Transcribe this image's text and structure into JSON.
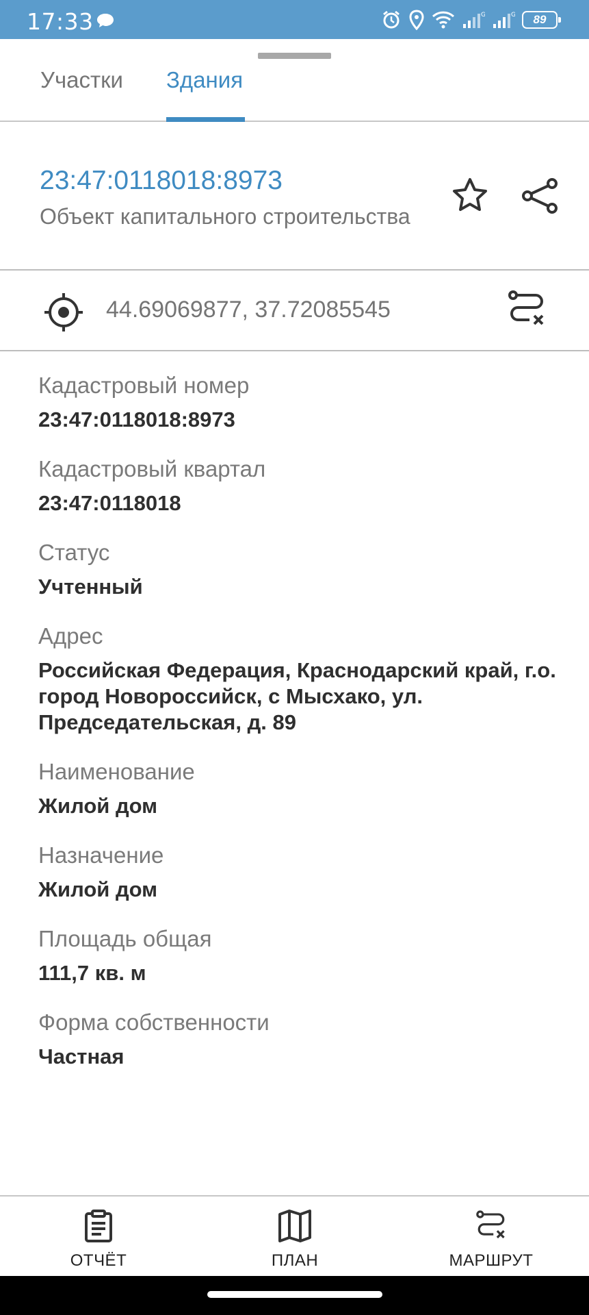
{
  "status_bar": {
    "time": "17:33",
    "battery": "89"
  },
  "tabs": [
    {
      "label": "Участки",
      "active": false
    },
    {
      "label": "Здания",
      "active": true
    }
  ],
  "object": {
    "cadastral_number": "23:47:0118018:8973",
    "type": "Объект капитального строительства"
  },
  "coordinates": "44.69069877, 37.72085545",
  "fields": [
    {
      "label": "Кадастровый номер",
      "value": "23:47:0118018:8973"
    },
    {
      "label": "Кадастровый квартал",
      "value": "23:47:0118018"
    },
    {
      "label": "Статус",
      "value": "Учтенный"
    },
    {
      "label": "Адрес",
      "value": "Российская Федерация, Краснодарский край, г.о. город Новороссийск, с Мысхако, ул. Председательская, д. 89"
    },
    {
      "label": "Наименование",
      "value": "Жилой дом"
    },
    {
      "label": "Назначение",
      "value": "Жилой дом"
    },
    {
      "label": "Площадь общая",
      "value": "111,7 кв. м"
    },
    {
      "label": "Форма собственности",
      "value": "Частная"
    }
  ],
  "bottom_nav": {
    "report": "ОТЧЁТ",
    "plan": "ПЛАН",
    "route": "МАРШРУТ"
  },
  "colors": {
    "accent": "#3f8bc2",
    "status_bar": "#5b9ccc"
  }
}
